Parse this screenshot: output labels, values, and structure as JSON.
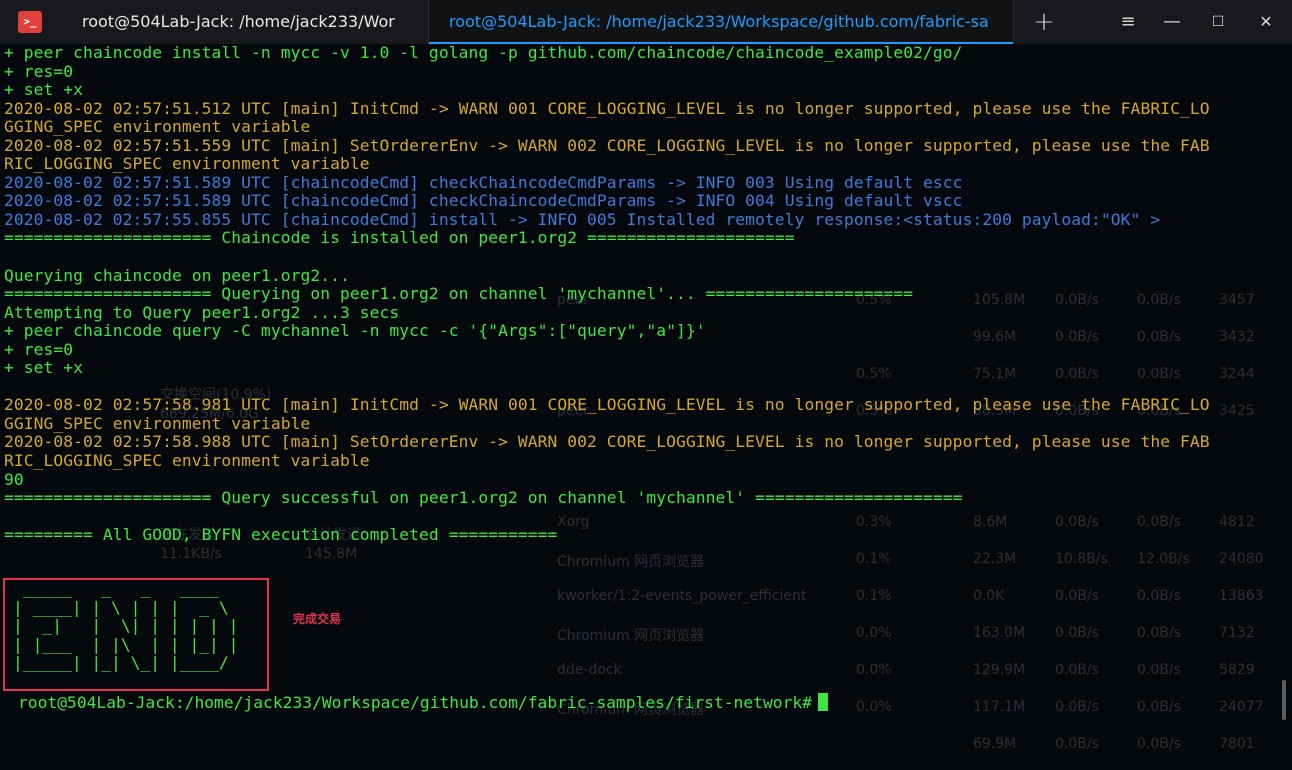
{
  "titlebar": {
    "app_icon": ">_",
    "tab1_title": "root@504Lab-Jack: /home/jack233/Wor",
    "tab2_title": "root@504Lab-Jack: /home/jack233/Workspace/github.com/fabric-sa",
    "new_tab": "+",
    "menu": "≡",
    "minimize": "—",
    "maximize": "☐",
    "close": "✕"
  },
  "terminal": {
    "lines": [
      {
        "t": "+ peer chaincode install -n mycc -v 1.0 -l golang -p github.com/chaincode/chaincode_example02/go/",
        "c": "green"
      },
      {
        "t": "+ res=0",
        "c": "green"
      },
      {
        "t": "+ set +x",
        "c": "green"
      },
      {
        "t": "2020-08-02 02:57:51.512 UTC [main] InitCmd -> WARN 001 CORE_LOGGING_LEVEL is no longer supported, please use the FABRIC_LO",
        "c": "yellow"
      },
      {
        "t": "GGING_SPEC environment variable",
        "c": "yellow"
      },
      {
        "t": "2020-08-02 02:57:51.559 UTC [main] SetOrdererEnv -> WARN 002 CORE_LOGGING_LEVEL is no longer supported, please use the FAB",
        "c": "yellow"
      },
      {
        "t": "RIC_LOGGING_SPEC environment variable",
        "c": "yellow"
      },
      {
        "t": "2020-08-02 02:57:51.589 UTC [chaincodeCmd] checkChaincodeCmdParams -> INFO 003 Using default escc",
        "c": "blue"
      },
      {
        "t": "2020-08-02 02:57:51.589 UTC [chaincodeCmd] checkChaincodeCmdParams -> INFO 004 Using default vscc",
        "c": "blue"
      },
      {
        "t": "2020-08-02 02:57:55.855 UTC [chaincodeCmd] install -> INFO 005 Installed remotely response:<status:200 payload:\"OK\" >",
        "c": "blue"
      },
      {
        "t": "===================== Chaincode is installed on peer1.org2 =====================",
        "c": "green"
      },
      {
        "t": "",
        "c": "green"
      },
      {
        "t": "Querying chaincode on peer1.org2...",
        "c": "green"
      },
      {
        "t": "===================== Querying on peer1.org2 on channel 'mychannel'... =====================",
        "c": "green"
      },
      {
        "t": "Attempting to Query peer1.org2 ...3 secs",
        "c": "green"
      },
      {
        "t": "+ peer chaincode query -C mychannel -n mycc -c '{\"Args\":[\"query\",\"a\"]}'",
        "c": "green"
      },
      {
        "t": "+ res=0",
        "c": "green"
      },
      {
        "t": "+ set +x",
        "c": "green"
      },
      {
        "t": "",
        "c": "green"
      },
      {
        "t": "2020-08-02 02:57:58.981 UTC [main] InitCmd -> WARN 001 CORE_LOGGING_LEVEL is no longer supported, please use the FABRIC_LO",
        "c": "yellow"
      },
      {
        "t": "GGING_SPEC environment variable",
        "c": "yellow"
      },
      {
        "t": "2020-08-02 02:57:58.988 UTC [main] SetOrdererEnv -> WARN 002 CORE_LOGGING_LEVEL is no longer supported, please use the FAB",
        "c": "yellow"
      },
      {
        "t": "RIC_LOGGING_SPEC environment variable",
        "c": "yellow"
      },
      {
        "t": "90",
        "c": "green"
      },
      {
        "t": "===================== Query successful on peer1.org2 on channel 'mychannel' =====================",
        "c": "green"
      },
      {
        "t": "",
        "c": "green"
      },
      {
        "t": "========= All GOOD, BYFN execution completed ===========",
        "c": "green"
      }
    ],
    "end_art": " _____   _   _   ____  \n| ____| | \\ | | |  _ \\ \n|  _|   |  \\| | | | | |\n| |___  | |\\  | | |_| |\n|_____| |_| \\_| |____/ ",
    "annotation": "完成交易",
    "prompt": "root@504Lab-Jack:/home/jack233/Workspace/github.com/fabric-samples/first-network#",
    "colors": {
      "green": "#3fe63f",
      "yellow": "#d4a72c",
      "blue": "#3d7ad8",
      "annotation": "#e2324f",
      "tab_active": "#1e9bff"
    }
  },
  "background_window": {
    "labels": [
      "交换空间(10.9%)",
      "669.25M/6.0G",
      "正在发送",
      "总计发送",
      "11.1KB/s",
      "145.8M"
    ],
    "process_rows": [
      {
        "name": "peer",
        "cpu": "0.5%",
        "mem": "105.8M",
        "w": "0.0B/s",
        "r": "0.0B/s",
        "pid": "3457"
      },
      {
        "name": "",
        "cpu": "",
        "mem": "99.6M",
        "w": "0.0B/s",
        "r": "0.0B/s",
        "pid": "3432"
      },
      {
        "name": "",
        "cpu": "0.5%",
        "mem": "75.1M",
        "w": "0.0B/s",
        "r": "0.0B/s",
        "pid": "3244"
      },
      {
        "name": "peer",
        "cpu": "0.5%",
        "mem": "58.5M",
        "w": "0.0B/s",
        "r": "0.0B/s",
        "pid": "3425"
      },
      {
        "name": "Xorg",
        "cpu": "0.3%",
        "mem": "8.6M",
        "w": "0.0B/s",
        "r": "0.0B/s",
        "pid": "4812"
      },
      {
        "name": "Chromium 网页浏览器",
        "cpu": "0.1%",
        "mem": "22.3M",
        "w": "10.8B/s",
        "r": "12.0B/s",
        "pid": "24080"
      },
      {
        "name": "kworker/1:2-events_power_efficient",
        "cpu": "0.1%",
        "mem": "0.0K",
        "w": "0.0B/s",
        "r": "0.0B/s",
        "pid": "13863"
      },
      {
        "name": "Chromium 网页浏览器",
        "cpu": "0.0%",
        "mem": "163.0M",
        "w": "0.0B/s",
        "r": "0.0B/s",
        "pid": "7132"
      },
      {
        "name": "dde-dock",
        "cpu": "0.0%",
        "mem": "129.9M",
        "w": "0.0B/s",
        "r": "0.0B/s",
        "pid": "5829"
      },
      {
        "name": "Chromium 网页浏览器",
        "cpu": "0.0%",
        "mem": "117.1M",
        "w": "0.0B/s",
        "r": "0.0B/s",
        "pid": "24077"
      },
      {
        "name": "",
        "cpu": "",
        "mem": "69.9M",
        "w": "0.0B/s",
        "r": "0.0B/s",
        "pid": "7801"
      }
    ]
  }
}
